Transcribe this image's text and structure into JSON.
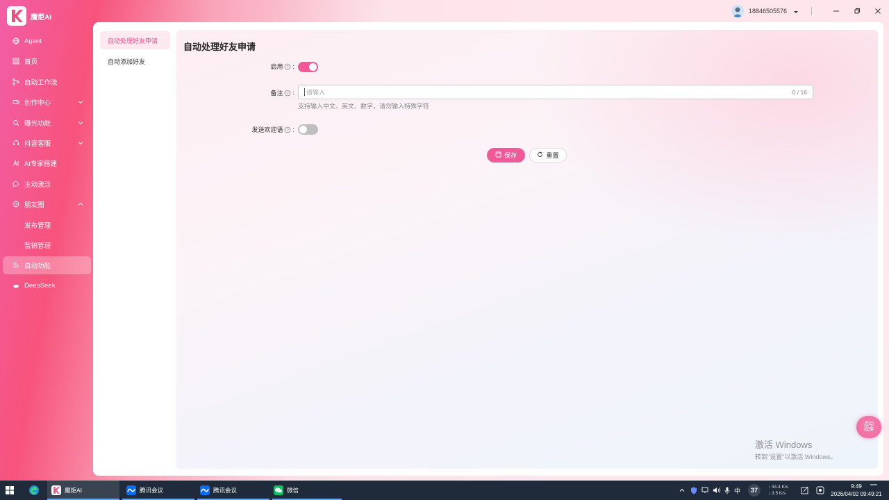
{
  "app": {
    "name": "魔炬AI",
    "user_phone": "18846505576"
  },
  "sidebar": {
    "items": [
      {
        "label": "Agent",
        "icon": "globe-icon"
      },
      {
        "label": "首页",
        "icon": "grid-icon"
      },
      {
        "label": "自动工作流",
        "icon": "workflow-icon"
      },
      {
        "label": "创作中心",
        "icon": "camera-icon"
      },
      {
        "label": "曝光功能",
        "icon": "search-icon"
      },
      {
        "label": "抖音客服",
        "icon": "headset-icon"
      },
      {
        "label": "AI专家搭建",
        "icon": "ai-icon"
      },
      {
        "label": "主动激活",
        "icon": "chat-icon"
      },
      {
        "label": "朋友圈",
        "icon": "moments-icon"
      },
      {
        "label": "发布管理"
      },
      {
        "label": "营销管理"
      },
      {
        "label": "自动功能",
        "icon": "auto-icon"
      },
      {
        "label": "DeepSeek",
        "icon": "deepseek-icon"
      }
    ]
  },
  "subnav": {
    "items": [
      "自动处理好友申请",
      "自动添加好友"
    ]
  },
  "page": {
    "title": "自动处理好友申请",
    "enable_label": "启用",
    "enable_on": true,
    "remark_label": "备注",
    "remark_placeholder": "请输入",
    "remark_counter": "0 / 16",
    "remark_hint": "支持输入中文、英文、数字，请勿输入特殊字符",
    "welcome_label": "发送欢迎语",
    "welcome_on": false,
    "save_label": "保存",
    "reset_label": "重置",
    "colon": ":"
  },
  "float_helper": {
    "line1": "启动",
    "line2": "程序"
  },
  "watermark": {
    "line1": "激活 Windows",
    "line2": "转到\"设置\"以激活 Windows。"
  },
  "taskbar": {
    "apps": [
      {
        "label": "魔炬AI"
      },
      {
        "label": "腾讯会议"
      },
      {
        "label": "腾讯会议"
      },
      {
        "label": "微信"
      }
    ],
    "ime": "中",
    "badge": "37",
    "net_up": "↑ 34.4 K/s",
    "net_down": "↓ 3.5 K/s",
    "time": "9:49",
    "datetime": "2026/04/02 09:49:21"
  },
  "colors": {
    "accent": "#f05a98",
    "taskbar": "#1f2b3a"
  }
}
